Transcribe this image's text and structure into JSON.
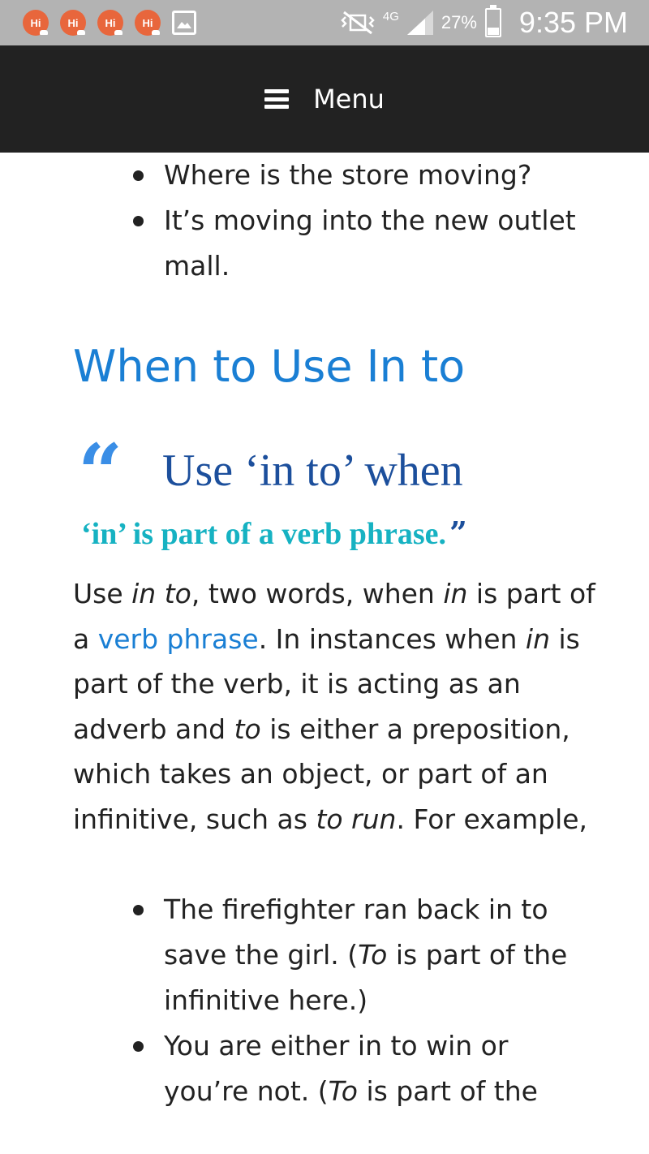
{
  "status_bar": {
    "notifications": [
      "Hi",
      "Hi",
      "Hi",
      "Hi"
    ],
    "network": "4G",
    "battery": "27%",
    "battery_level": 0.27,
    "time": "9:35 PM"
  },
  "nav": {
    "menu_label": "Menu"
  },
  "top_list": [
    "Where is the store moving?",
    "It’s moving into the new outlet mall."
  ],
  "section_heading": "When to Use In to",
  "quote": {
    "line1": "Use ‘in to’ when",
    "line2": "‘in’ is part of a verb phrase."
  },
  "paragraph": {
    "t1": "Use ",
    "e1": "in to",
    "t2": ", two words, when ",
    "e2": "in",
    "t3": " is part of a ",
    "link": "verb phrase",
    "t4": ". In instances when ",
    "e3": "in",
    "t5": " is part of the verb, it is acting as an adverb and ",
    "e4": "to",
    "t6": " is either a preposition, which takes an object, or part of an infinitive, such as ",
    "e5": "to run",
    "t7": ". For example,"
  },
  "bottom_list": [
    {
      "text1": "The firefighter ran back in to save the girl. (",
      "emph": "To",
      "text2": " is part of the infinitive here.)"
    },
    {
      "text1": "You are either in to win or you’re not. (",
      "emph": "To",
      "text2": " is part of the"
    }
  ],
  "colors": {
    "heading": "#1a7fd4",
    "menu_bg": "#222222",
    "status_bg": "#b3b3b3",
    "quote_dark": "#1c4f9c",
    "quote_teal": "#16b2c2"
  }
}
